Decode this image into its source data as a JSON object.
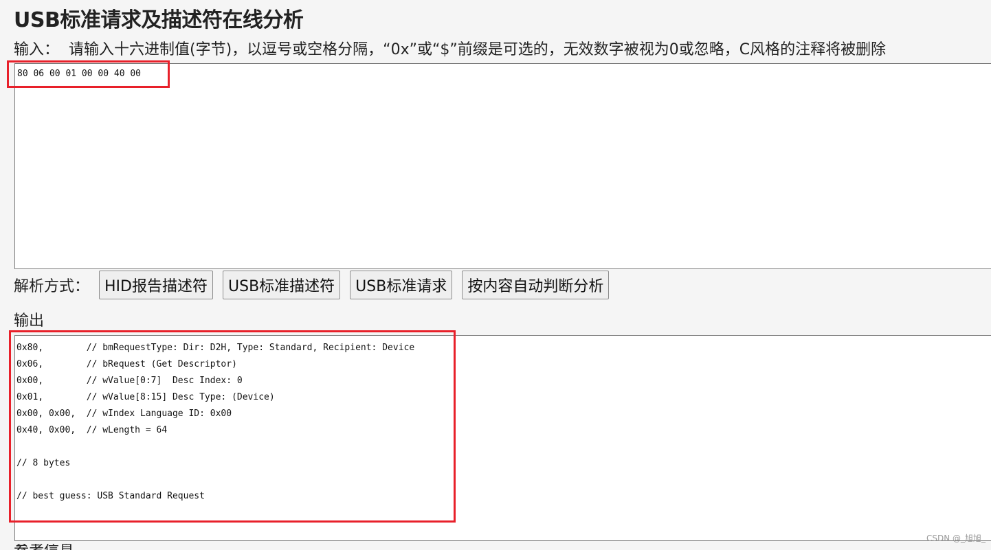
{
  "page": {
    "title": "USB标准请求及描述符在线分析"
  },
  "input": {
    "label": "输入：",
    "hint": "请输入十六进制值(字节)，以逗号或空格分隔，“0x”或“$”前缀是可选的，无效数字被视为0或忽略，C风格的注释将被删除",
    "value": "80 06 00 01 00 00 40 00"
  },
  "parse": {
    "label": "解析方式：",
    "buttons": [
      "HID报告描述符",
      "USB标准描述符",
      "USB标准请求",
      "按内容自动判断分析"
    ]
  },
  "output": {
    "label": "输出",
    "lines": [
      "0x80,        // bmRequestType: Dir: D2H, Type: Standard, Recipient: Device",
      "0x06,        // bRequest (Get Descriptor)",
      "0x00,        // wValue[0:7]  Desc Index: 0",
      "0x01,        // wValue[8:15] Desc Type: (Device)",
      "0x00, 0x00,  // wIndex Language ID: 0x00",
      "0x40, 0x00,  // wLength = 64",
      "",
      "// 8 bytes",
      "",
      "// best guess: USB Standard Request"
    ]
  },
  "footer": {
    "next_section_label": "参考信息",
    "watermark": "CSDN @_旭旭_"
  },
  "colors": {
    "highlight": "#e8202a",
    "background": "#f5f5f5"
  }
}
